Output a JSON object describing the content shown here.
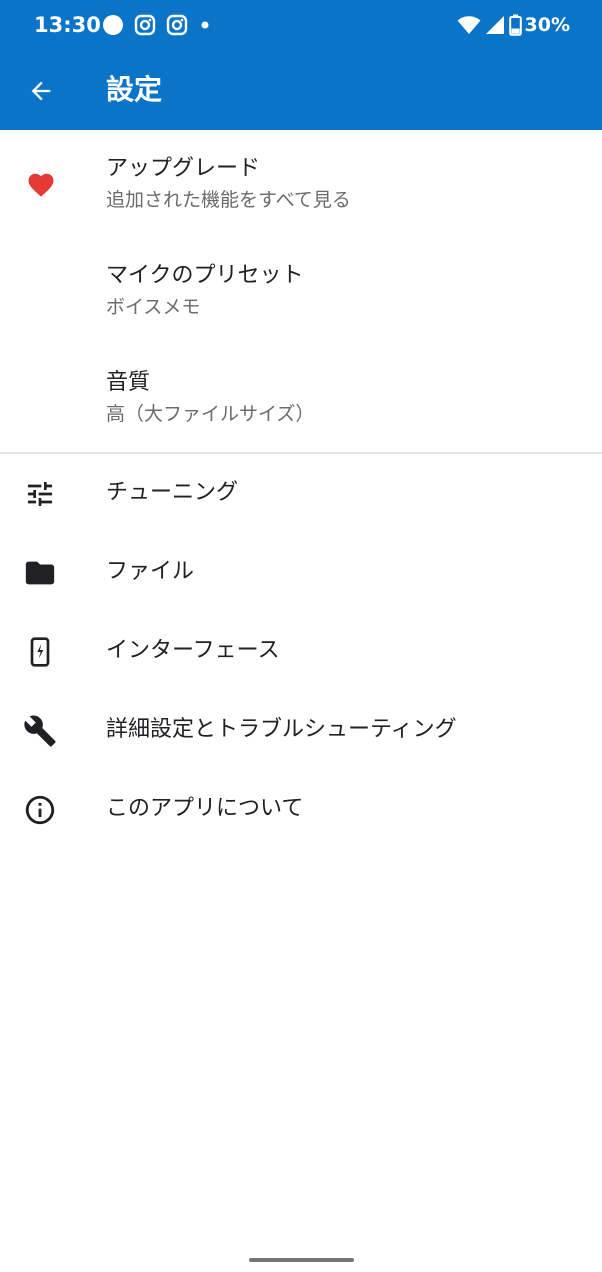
{
  "status_bar": {
    "time": "13:30",
    "battery": "30%",
    "icons_left": [
      "circle-notification-icon",
      "instagram-icon",
      "instagram-icon",
      "dot-icon"
    ],
    "icons_right": [
      "wifi-icon",
      "signal-icon",
      "battery-icon"
    ]
  },
  "app_bar": {
    "title": "設定",
    "back_icon": "arrow-back-icon"
  },
  "colors": {
    "primary": "#0a74c9",
    "heart": "#e53935",
    "text": "#202124",
    "subtext": "#6b6b6b"
  },
  "settings": {
    "upgrade": {
      "title": "アップグレード",
      "subtitle": "追加された機能をすべて見る",
      "icon": "heart-icon"
    },
    "mic_preset": {
      "title": "マイクのプリセット",
      "subtitle": "ボイスメモ"
    },
    "quality": {
      "title": "音質",
      "subtitle": "高（大ファイルサイズ）"
    }
  },
  "menu": [
    {
      "label": "チューニング",
      "icon": "tune-sliders-icon"
    },
    {
      "label": "ファイル",
      "icon": "folder-icon"
    },
    {
      "label": "インターフェース",
      "icon": "phone-interface-icon"
    },
    {
      "label": "詳細設定とトラブルシューティング",
      "icon": "wrench-icon"
    },
    {
      "label": "このアプリについて",
      "icon": "info-icon"
    }
  ]
}
